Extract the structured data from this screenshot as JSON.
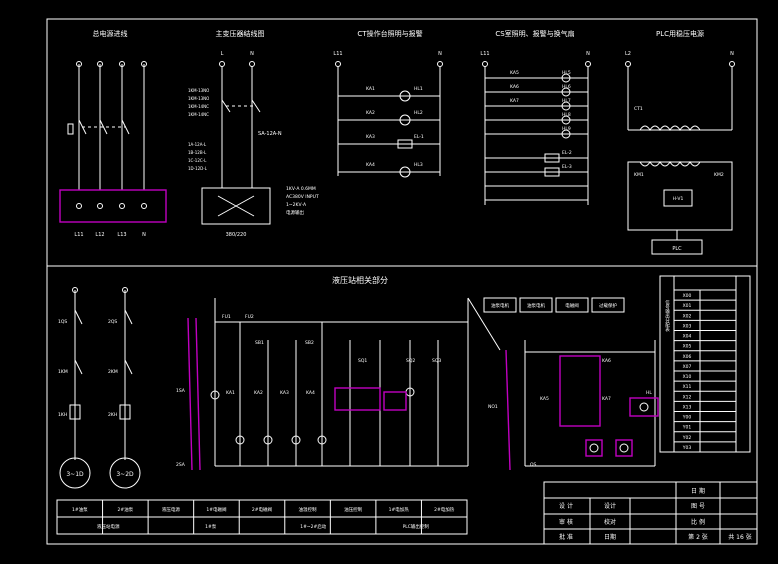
{
  "sections": {
    "main_power": "总电源进线",
    "transformer": "主变压器结线图",
    "control_light": "CT操作台照明与报警",
    "cabin_light": "CS室照明、报警与换气扇",
    "plc_power": "PLC用稳压电源",
    "hydraulic": "液压站相关部分"
  },
  "main_power_labels": [
    "L11",
    "L12",
    "L13",
    "N"
  ],
  "transformer_labels": {
    "top": [
      "L",
      "N"
    ],
    "bottom": "380/220",
    "coil": "SA-12A-N"
  },
  "transformer_specs": [
    "1KV·A 0.6MM",
    "AC380V INPUT",
    "1~2KV·A",
    "电源输出"
  ],
  "ct_light_labels": [
    "L11",
    "N",
    "HL1",
    "HL2",
    "HL3",
    "HL4",
    "KA1",
    "KA2",
    "KA3",
    "KA4",
    "EL-1"
  ],
  "cs_light_labels": [
    "L11",
    "N",
    "HL5",
    "HL6",
    "HL7",
    "HL8",
    "HL9",
    "HL10",
    "EL-2",
    "EL-3",
    "KA5",
    "KA6",
    "KA7"
  ],
  "plc_labels": [
    "L2",
    "N",
    "L1",
    "PLC",
    "CT1",
    "KM1",
    "KM2",
    "H-V1"
  ],
  "motor_labels": [
    "3~1D",
    "3~2D"
  ],
  "hyd_labels": [
    "1QS",
    "2QS",
    "1KM",
    "2KM",
    "1KH",
    "2KH",
    "FU1",
    "FU2",
    "SB1",
    "SB2",
    "KA1",
    "KA2",
    "KA3",
    "KA4",
    "SQ1",
    "SQ2",
    "SQ3",
    "1SA",
    "2SA"
  ],
  "hyd_right_labels": [
    "NO1",
    "KA5",
    "KA6",
    "KA7",
    "QS",
    "HL"
  ],
  "func_boxes": [
    "油泵电机",
    "油泵电机",
    "电磁阀",
    "过载保护"
  ],
  "right_table_title": "信号输出分配表",
  "right_table_rows": [
    "X00",
    "X01",
    "X02",
    "X03",
    "X04",
    "X05",
    "X06",
    "X07",
    "X10",
    "X11",
    "X12",
    "X13",
    "Y00",
    "Y01",
    "Y02",
    "Y03"
  ],
  "bottom_strip": [
    "1#油泵",
    "2#油泵",
    "液压电源",
    "1#电磁阀",
    "2#电磁阀",
    "油温控制",
    "油压控制",
    "1#电加热",
    "2#电加热"
  ],
  "bottom_strip_row2": [
    "液压站电源",
    "1#泵",
    "1#~2#启动",
    "PLC输出控制"
  ],
  "title_block": {
    "left_labels": [
      "设 计",
      "审 核",
      "批 准"
    ],
    "mid_labels": [
      "设计",
      "校对",
      "日期"
    ],
    "right_labels": [
      "日 期",
      "图 号",
      "比 例"
    ],
    "sheet": "第 2 张",
    "total": "共 16 张"
  }
}
